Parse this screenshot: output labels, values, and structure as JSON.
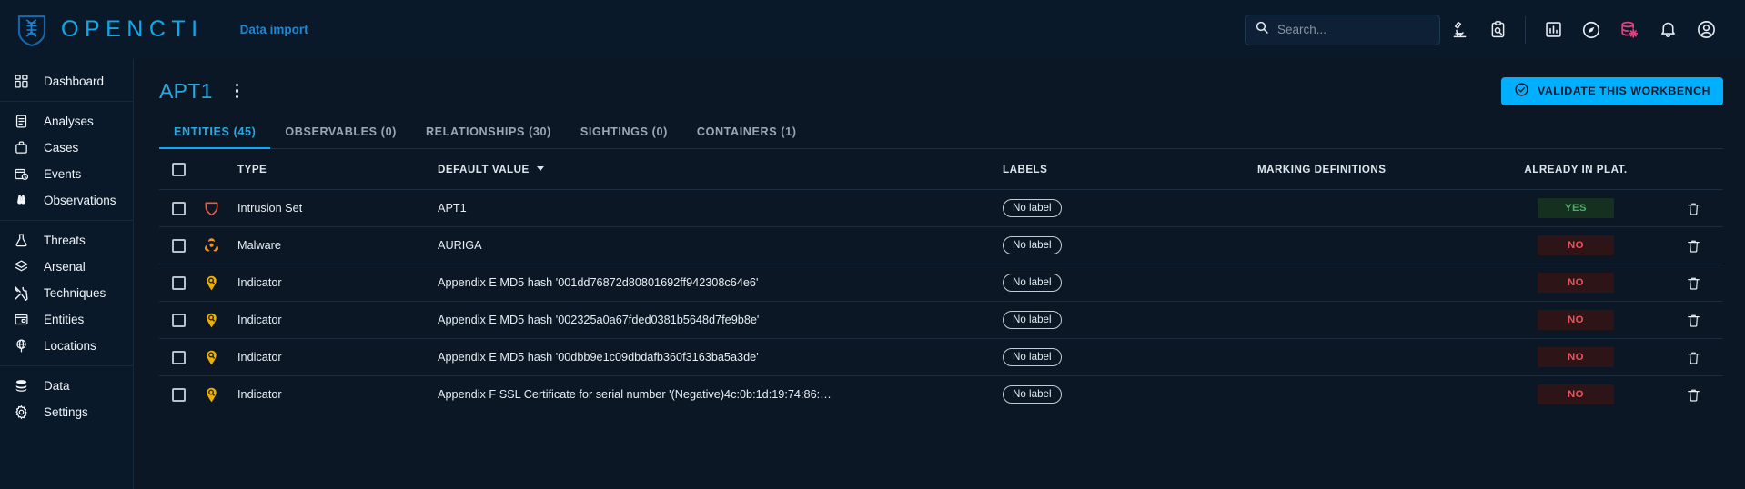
{
  "app": {
    "brand": "OPENCTI",
    "brand_icon": "opencti-shield-dna-logo",
    "nav_link": "Data import"
  },
  "search": {
    "placeholder": "Search...",
    "value": "",
    "icon": "search-icon"
  },
  "topbar_icons": [
    {
      "name": "microscope-icon",
      "label": "Investigations"
    },
    {
      "name": "clipboard-search-icon",
      "label": "Reports"
    },
    {
      "name": "insights-chart-icon",
      "label": "Dashboards"
    },
    {
      "name": "compass-explore-icon",
      "label": "Explore"
    },
    {
      "name": "database-gear-icon",
      "label": "Data management",
      "color": "#e7407f"
    },
    {
      "name": "bell-notification-icon",
      "label": "Notifications"
    },
    {
      "name": "account-circle-icon",
      "label": "Profile"
    }
  ],
  "sidebar": {
    "groups": [
      {
        "items": [
          {
            "label": "Dashboard",
            "icon": "dashboard-grid-icon"
          }
        ]
      },
      {
        "items": [
          {
            "label": "Analyses",
            "icon": "document-analysis-icon"
          },
          {
            "label": "Cases",
            "icon": "briefcase-case-icon"
          },
          {
            "label": "Events",
            "icon": "calendar-clock-event-icon"
          },
          {
            "label": "Observations",
            "icon": "binoculars-icon"
          }
        ]
      },
      {
        "items": [
          {
            "label": "Threats",
            "icon": "flask-threat-icon"
          },
          {
            "label": "Arsenal",
            "icon": "layers-arsenal-icon"
          },
          {
            "label": "Techniques",
            "icon": "tools-techniques-icon"
          },
          {
            "label": "Entities",
            "icon": "archive-entities-icon"
          },
          {
            "label": "Locations",
            "icon": "globe-pin-location-icon"
          }
        ]
      },
      {
        "items": [
          {
            "label": "Data",
            "icon": "database-stack-icon"
          },
          {
            "label": "Settings",
            "icon": "gear-settings-icon"
          }
        ]
      }
    ]
  },
  "page": {
    "title": "APT1",
    "kebab_name": "more-options-icon",
    "validate_button": {
      "label": "VALIDATE THIS WORKBENCH",
      "icon": "check-circle-icon",
      "color": "#00b0ff"
    }
  },
  "tabs": [
    {
      "label": "ENTITIES (45)",
      "active": true
    },
    {
      "label": "OBSERVABLES (0)",
      "active": false
    },
    {
      "label": "RELATIONSHIPS (30)",
      "active": false
    },
    {
      "label": "SIGHTINGS (0)",
      "active": false
    },
    {
      "label": "CONTAINERS (1)",
      "active": false
    }
  ],
  "table": {
    "columns": {
      "type": "TYPE",
      "default_value": "DEFAULT VALUE",
      "labels": "LABELS",
      "marking_definitions": "MARKING DEFINITIONS",
      "already_in_plat": "ALREADY IN PLAT."
    },
    "sorted_column": "default_value",
    "sort_direction": "desc",
    "select_all_checked": false,
    "rows": [
      {
        "type": "Intrusion Set",
        "type_icon": "intrusion-set-icon",
        "type_icon_color": "#ef5b3f",
        "default_value": "APT1",
        "label": "No label",
        "marking": "",
        "already_in_platform": "YES",
        "already_state": "yes",
        "delete_icon": "trash-icon"
      },
      {
        "type": "Malware",
        "type_icon": "biohazard-malware-icon",
        "type_icon_color": "#f39121",
        "default_value": "AURIGA",
        "label": "No label",
        "marking": "",
        "already_in_platform": "NO",
        "already_state": "no",
        "delete_icon": "trash-icon"
      },
      {
        "type": "Indicator",
        "type_icon": "indicator-shield-icon",
        "type_icon_color": "#ecb100",
        "default_value": "Appendix E MD5 hash '001dd76872d80801692ff942308c64e6'",
        "label": "No label",
        "marking": "",
        "already_in_platform": "NO",
        "already_state": "no",
        "delete_icon": "trash-icon"
      },
      {
        "type": "Indicator",
        "type_icon": "indicator-shield-icon",
        "type_icon_color": "#ecb100",
        "default_value": "Appendix E MD5 hash '002325a0a67fded0381b5648d7fe9b8e'",
        "label": "No label",
        "marking": "",
        "already_in_platform": "NO",
        "already_state": "no",
        "delete_icon": "trash-icon"
      },
      {
        "type": "Indicator",
        "type_icon": "indicator-shield-icon",
        "type_icon_color": "#ecb100",
        "default_value": "Appendix E MD5 hash '00dbb9e1c09dbdafb360f3163ba5a3de'",
        "label": "No label",
        "marking": "",
        "already_in_platform": "NO",
        "already_state": "no",
        "delete_icon": "trash-icon"
      },
      {
        "type": "Indicator",
        "type_icon": "indicator-shield-icon",
        "type_icon_color": "#ecb100",
        "default_value": "Appendix F SSL Certificate for serial number '(Negative)4c:0b:1d:19:74:86:…",
        "label": "No label",
        "marking": "",
        "already_in_platform": "NO",
        "already_state": "no",
        "delete_icon": "trash-icon"
      }
    ]
  }
}
